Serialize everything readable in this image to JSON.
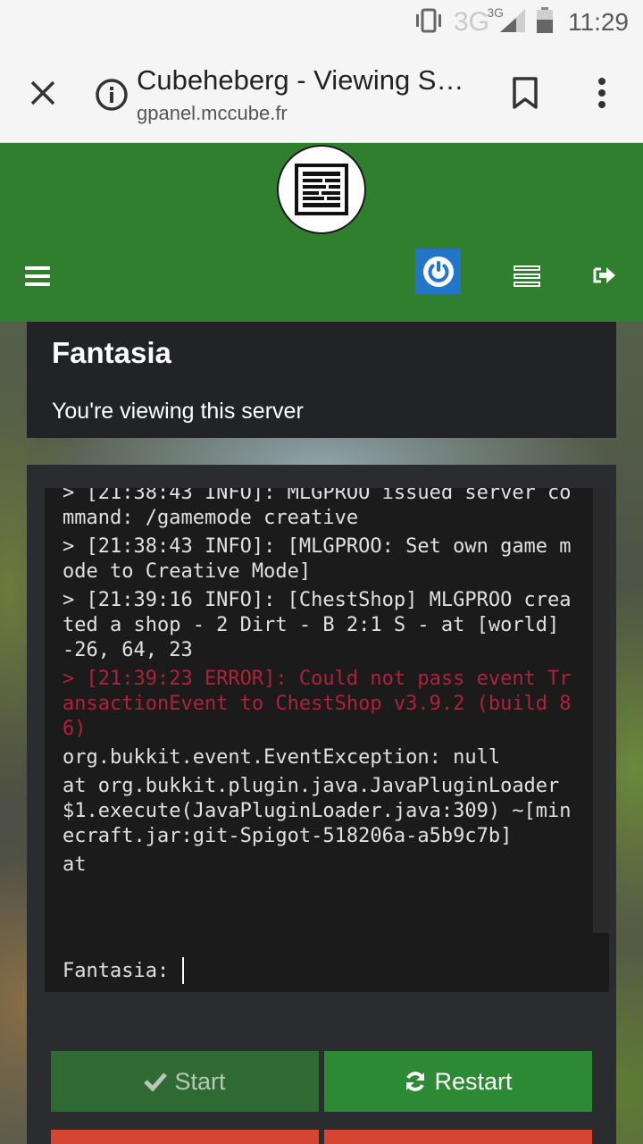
{
  "status_bar": {
    "network": "3G",
    "network_small": "3G",
    "time": "11:29"
  },
  "browser": {
    "title": "Cubeheberg - Viewing S…",
    "url": "gpanel.mccube.fr"
  },
  "header": {
    "icons": [
      "menu-icon",
      "power-icon",
      "servers-icon",
      "logout-icon"
    ]
  },
  "server": {
    "name": "Fantasia",
    "subtitle": "You're viewing this server"
  },
  "console": {
    "lines": [
      {
        "text": "> [21:38:43 INFO]: MLGPROO issued server command: /gamemode creative",
        "type": "info"
      },
      {
        "text": "> [21:38:43 INFO]: [MLGPROO: Set own game mode to Creative Mode]",
        "type": "info"
      },
      {
        "text": "> [21:39:16 INFO]: [ChestShop] MLGPROO created a shop - 2 Dirt - B 2:1 S - at [world] -26, 64, 23",
        "type": "info"
      },
      {
        "text": "> [21:39:23 ERROR]: Could not pass event TransactionEvent to ChestShop v3.9.2 (build 86)",
        "type": "error"
      },
      {
        "text": "org.bukkit.event.EventException: null",
        "type": "info"
      },
      {
        "text": "at org.bukkit.plugin.java.JavaPluginLoader$1.execute(JavaPluginLoader.java:309) ~[minecraft.jar:git-Spigot-518206a-a5b9c7b]",
        "type": "info"
      },
      {
        "text": "at",
        "type": "info"
      }
    ],
    "prompt": "Fantasia:"
  },
  "actions": {
    "start_label": "Start",
    "restart_label": "Restart"
  },
  "colors": {
    "header_green": "#2f7f2e",
    "error_red": "#b0213a",
    "power_blue": "#2176c9",
    "stop_red": "#d64531"
  }
}
